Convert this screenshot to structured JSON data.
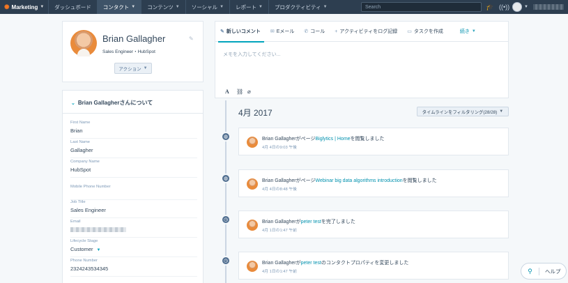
{
  "nav": {
    "brand": "Marketing",
    "items": [
      "ダッシュボード",
      "コンタクト",
      "コンテンツ",
      "ソーシャル",
      "レポート",
      "プロダクティビティ"
    ],
    "active_index": 1,
    "search_placeholder": "Search",
    "icons": [
      "academy-icon",
      "notifications-icon",
      "avatar"
    ]
  },
  "profile": {
    "name": "Brian Gallagher",
    "title": "Sales Engineer・HubSpot",
    "action_label": "アクション"
  },
  "about": {
    "heading": "Brian Gallagherさんについて",
    "properties": [
      {
        "label": "First Name",
        "value": "Brian"
      },
      {
        "label": "Last Name",
        "value": "Gallagher"
      },
      {
        "label": "Company Name",
        "value": "HubSpot"
      },
      {
        "label": "Mobile Phone Number",
        "value": ""
      },
      {
        "label": "Job Title",
        "value": "Sales Engineer"
      },
      {
        "label": "Email",
        "value": ""
      },
      {
        "label": "Lifecycle Stage",
        "value": "Customer"
      },
      {
        "label": "Phone Number",
        "value": "2324243534345"
      }
    ]
  },
  "composer": {
    "tabs": [
      {
        "label": "新しいコメント",
        "icon": "note-icon"
      },
      {
        "label": "Eメール",
        "icon": "email-icon"
      },
      {
        "label": "コール",
        "icon": "phone-icon"
      },
      {
        "label": "アクティビティをログ記録",
        "icon": "plus-icon"
      },
      {
        "label": "タスクを作成",
        "icon": "task-icon"
      }
    ],
    "more_label": "続き",
    "placeholder": "メモを入力してください..."
  },
  "timeline": {
    "month": "4月 2017",
    "filter_label": "タイムラインをフィルタリング(28/28)",
    "events": [
      {
        "icon": "globe-icon",
        "prefix": "Brian Gallagherがページ",
        "link": "Biglytics | Home",
        "suffix": "を閲覧しました",
        "time": "4月 4日の9:03 午後"
      },
      {
        "icon": "globe-icon",
        "prefix": "Brian Gallagherがページ",
        "link": "Webinar big data algorithms introduction",
        "suffix": "を閲覧しました",
        "time": "4月 4日の8:48 午後"
      },
      {
        "icon": "clock-icon",
        "prefix": "Brian Gallagherが",
        "link": "peter test",
        "suffix": "を完了しました",
        "time": "4月 1日の1:47 午前"
      },
      {
        "icon": "clock-icon",
        "prefix": "Brian Gallagherが",
        "link": "peter test",
        "suffix": "のコンタクトプロパティを変更しました",
        "time": "4月 1日の1:47 午前"
      }
    ]
  },
  "help": {
    "label": "ヘルプ"
  }
}
